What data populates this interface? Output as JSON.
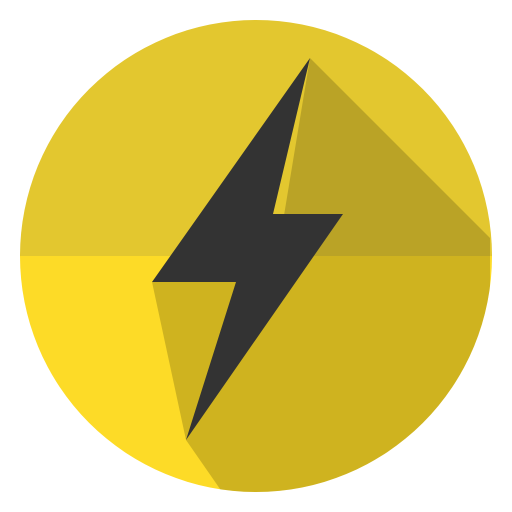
{
  "icon": {
    "name": "lightning-bolt-icon",
    "shape": "circle",
    "colors": {
      "circle_top": "#E3C72F",
      "circle_bottom": "#FDDB27",
      "bolt": "#333333",
      "long_shadow": "#000000",
      "background": "#FFFFFF"
    }
  }
}
